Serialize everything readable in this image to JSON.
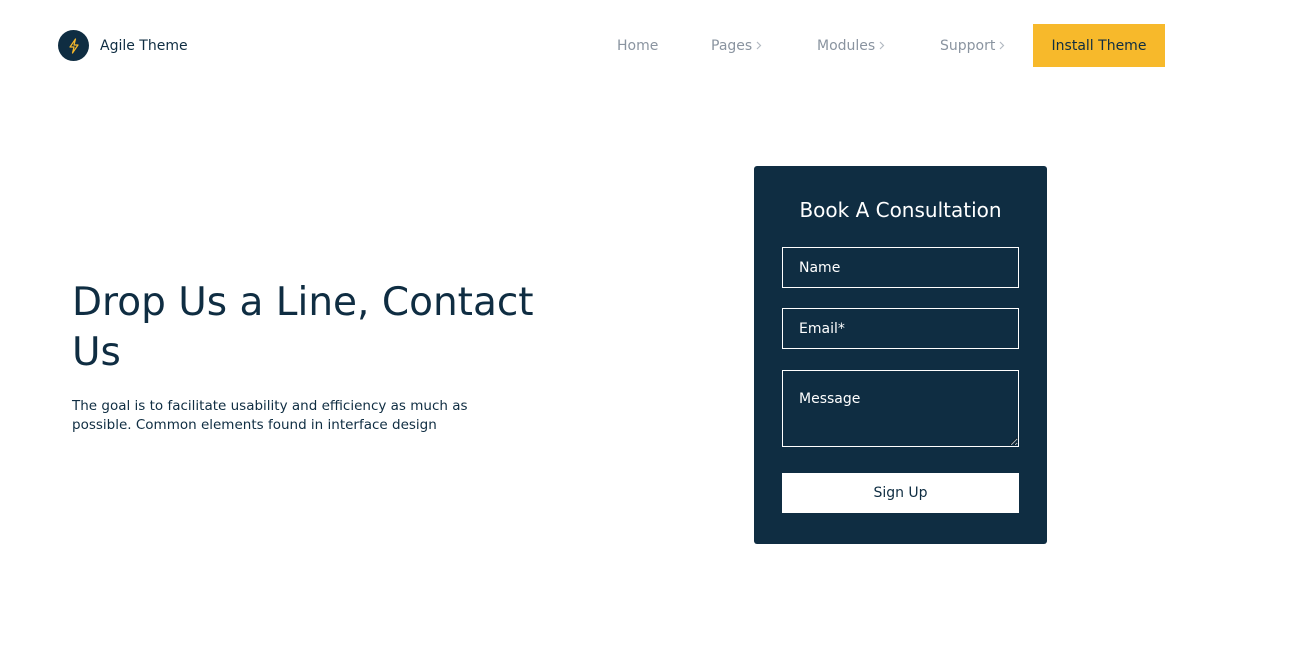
{
  "brand": {
    "name": "Agile Theme",
    "icon": "lightning-bolt-icon",
    "badge_color": "#0f2d42",
    "icon_color": "#f7b92b"
  },
  "nav": {
    "items": [
      {
        "label": "Home",
        "has_submenu": false
      },
      {
        "label": "Pages",
        "has_submenu": true
      },
      {
        "label": "Modules",
        "has_submenu": true
      },
      {
        "label": "Support",
        "has_submenu": true
      }
    ],
    "cta_label": "Install Theme",
    "cta_color": "#f7b92b"
  },
  "hero": {
    "title": "Drop Us a Line, Contact Us",
    "description": "The goal is to facilitate usability and efficiency as much as possible. Common elements found in interface design"
  },
  "form": {
    "title": "Book A Consultation",
    "name_placeholder": "Name",
    "email_placeholder": "Email*",
    "message_placeholder": "Message",
    "submit_label": "Sign Up",
    "background": "#0f2d42"
  }
}
